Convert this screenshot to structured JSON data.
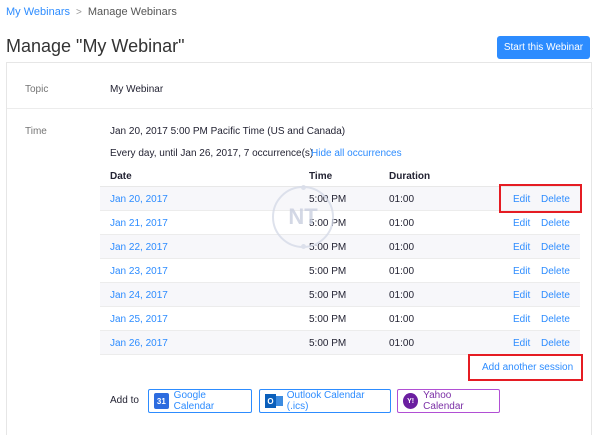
{
  "breadcrumb": {
    "parent": "My Webinars",
    "separator": ">",
    "current": "Manage Webinars"
  },
  "page": {
    "title": "Manage \"My Webinar\"",
    "start_button": "Start this Webinar"
  },
  "topic": {
    "label": "Topic",
    "value": "My Webinar"
  },
  "time": {
    "label": "Time",
    "value": "Jan 20, 2017 5:00 PM Pacific Time (US and Canada)",
    "recurrence": "Every day, until Jan 26, 2017, 7 occurrence(s)",
    "toggle_link": "Hide all occurrences"
  },
  "occurrences": {
    "headers": {
      "date": "Date",
      "time": "Time",
      "duration": "Duration"
    },
    "edit_label": "Edit",
    "delete_label": "Delete",
    "rows": [
      {
        "date": "Jan 20, 2017",
        "time": "5:00 PM",
        "duration": "01:00"
      },
      {
        "date": "Jan 21, 2017",
        "time": "5:00 PM",
        "duration": "01:00"
      },
      {
        "date": "Jan 22, 2017",
        "time": "5:00 PM",
        "duration": "01:00"
      },
      {
        "date": "Jan 23, 2017",
        "time": "5:00 PM",
        "duration": "01:00"
      },
      {
        "date": "Jan 24, 2017",
        "time": "5:00 PM",
        "duration": "01:00"
      },
      {
        "date": "Jan 25, 2017",
        "time": "5:00 PM",
        "duration": "01:00"
      },
      {
        "date": "Jan 26, 2017",
        "time": "5:00 PM",
        "duration": "01:00"
      }
    ],
    "add_session": "Add another session"
  },
  "calendar": {
    "label": "Add to",
    "google": {
      "label": "Google Calendar",
      "icon_text": "31"
    },
    "outlook": {
      "label": "Outlook Calendar (.ics)",
      "icon_text": "O"
    },
    "yahoo": {
      "label": "Yahoo Calendar",
      "icon_text": "Y!"
    }
  },
  "watermark": {
    "text": "NT"
  },
  "colors": {
    "accent": "#2d8cff",
    "highlight": "#e51c23",
    "yahoo": "#6b1fa0"
  }
}
